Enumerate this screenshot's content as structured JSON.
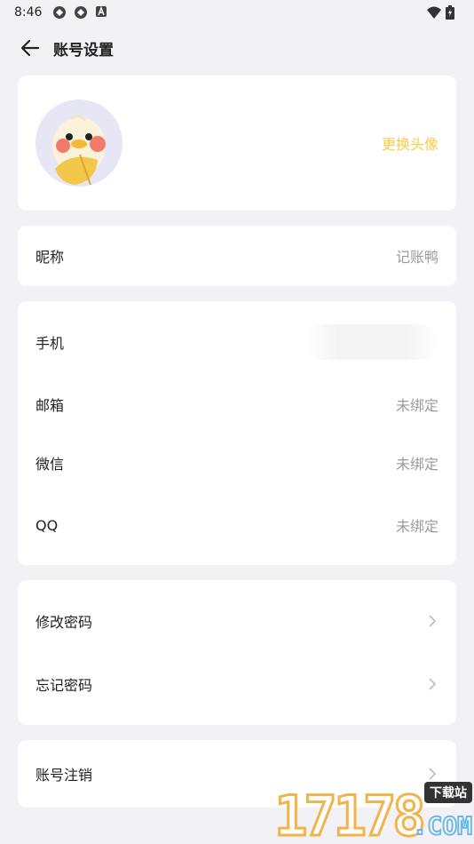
{
  "status": {
    "time": "8:46",
    "icons": [
      "sync-icon",
      "sync-icon",
      "font-app-icon"
    ],
    "right_icons": [
      "wifi-icon",
      "battery-icon"
    ]
  },
  "header": {
    "title": "账号设置"
  },
  "avatar_card": {
    "change_label": "更换头像"
  },
  "nickname": {
    "label": "昵称",
    "value": "记账鸭"
  },
  "bindings": [
    {
      "label": "手机",
      "value": ""
    },
    {
      "label": "邮箱",
      "value": "未绑定"
    },
    {
      "label": "微信",
      "value": "未绑定"
    },
    {
      "label": "QQ",
      "value": "未绑定"
    }
  ],
  "password": [
    {
      "label": "修改密码"
    },
    {
      "label": "忘记密码"
    }
  ],
  "account": {
    "delete_label": "账号注销"
  },
  "watermark": {
    "digits": "17178",
    "badge": "下载站",
    "suffix": ".COM"
  },
  "colors": {
    "accent": "#f5cd46",
    "background": "#f2f2f6",
    "muted": "#9a9a9a"
  }
}
